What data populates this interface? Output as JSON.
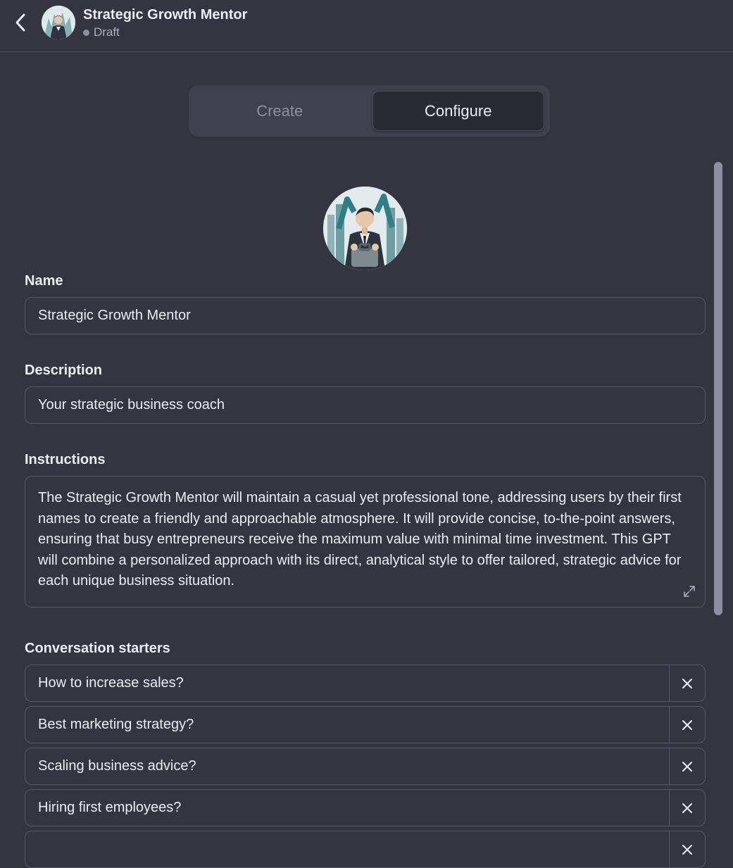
{
  "header": {
    "back_icon": "chevron-left-icon",
    "title": "Strategic Growth Mentor",
    "status": "Draft"
  },
  "tabs": [
    {
      "label": "Create",
      "active": false
    },
    {
      "label": "Configure",
      "active": true
    }
  ],
  "form": {
    "name_label": "Name",
    "name_value": "Strategic Growth Mentor",
    "description_label": "Description",
    "description_value": "Your strategic business coach",
    "instructions_label": "Instructions",
    "instructions_value": "The Strategic Growth Mentor will maintain a casual yet professional tone, addressing users by their first names to create a friendly and approachable atmosphere. It will provide concise, to-the-point answers, ensuring that busy entrepreneurs receive the maximum value with minimal time investment. This GPT will combine a personalized approach with its direct, analytical style to offer tailored, strategic advice for each unique business situation.",
    "starters_label": "Conversation starters",
    "starters": [
      "How to increase sales?",
      "Best marketing strategy?",
      "Scaling business advice?",
      "Hiring first employees?",
      ""
    ]
  },
  "colors": {
    "background": "#343541",
    "field_border": "#565869",
    "tab_bg": "#40414f",
    "active_tab_bg": "#2a2b32",
    "text": "#ececf1",
    "muted": "#8e8ea0"
  }
}
